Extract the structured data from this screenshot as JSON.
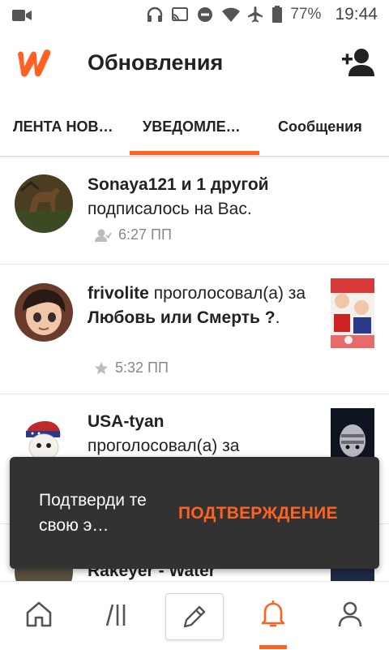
{
  "status_bar": {
    "battery": "77%",
    "time": "19:44",
    "icons": [
      "video-camera-icon",
      "headphones-icon",
      "cast-icon",
      "do-not-disturb-icon",
      "wifi-icon",
      "airplane-icon",
      "battery-icon"
    ]
  },
  "app_bar": {
    "title": "Обновления",
    "logo": "wattpad-logo",
    "action_icon": "add-user-icon"
  },
  "tabs": [
    {
      "label": "ЛЕНТА НОВ…",
      "active": false
    },
    {
      "label": "УВЕДОМЛЕ…",
      "active": true
    },
    {
      "label": "Сообщения",
      "active": false
    }
  ],
  "notifications": [
    {
      "user": "Sonaya121 и 1 другой",
      "action": "подписалось на Вас.",
      "time": "6:27 ПП",
      "meta_icon": "follow-icon"
    },
    {
      "user": "frivolite",
      "action": " проголосовал(а) за ",
      "story": "Любовь или Смерть ?",
      "time": "5:32 ПП",
      "meta_icon": "star-icon"
    },
    {
      "user": "USA-tyan",
      "action": "проголосовал(а) за"
    },
    {
      "user": "Rakeyer - Water"
    }
  ],
  "snackbar": {
    "message": "Подтверди те свою э…",
    "action": "ПОДТВЕРЖДЕНИЕ"
  },
  "bottom_nav": [
    {
      "icon": "home-icon",
      "active": false
    },
    {
      "icon": "library-icon",
      "active": false
    },
    {
      "icon": "pencil-icon",
      "active": false
    },
    {
      "icon": "bell-icon",
      "active": true
    },
    {
      "icon": "profile-icon",
      "active": false
    }
  ],
  "colors": {
    "accent": "#ff6122",
    "snackbar_bg": "#323232",
    "text": "#222222",
    "muted": "#888888"
  }
}
